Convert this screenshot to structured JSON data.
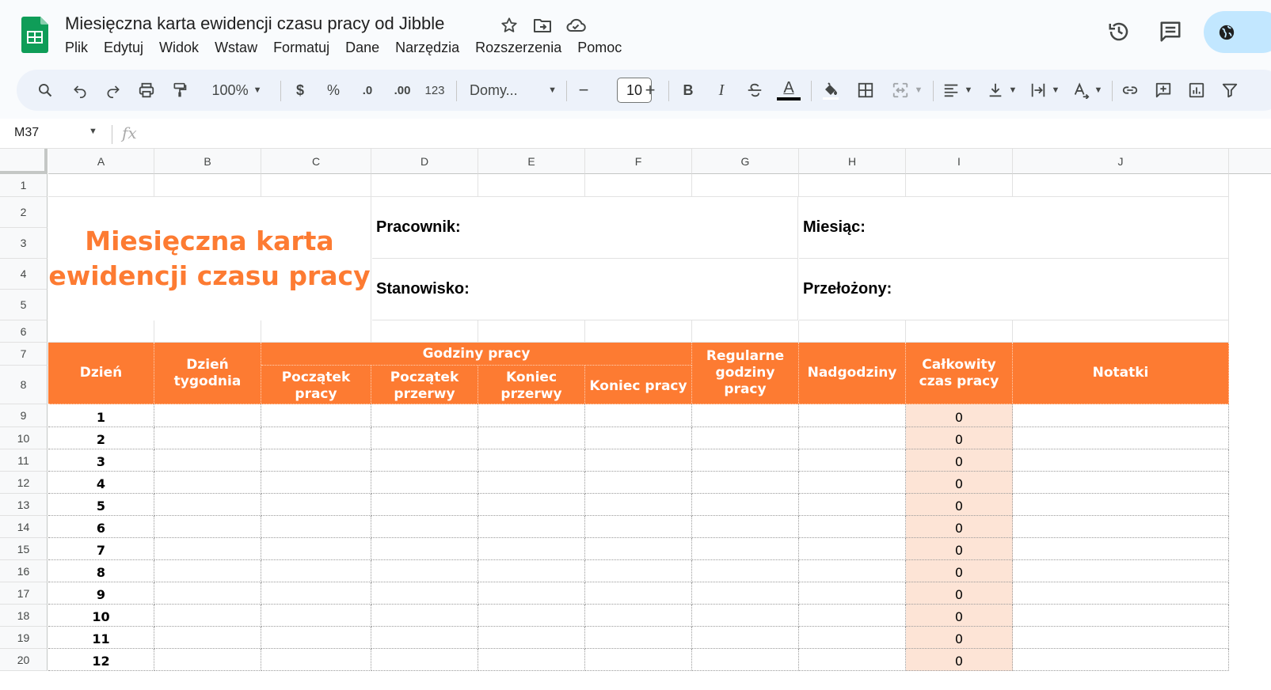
{
  "document": {
    "title": "Miesięczna karta ewidencji czasu pracy od Jibble"
  },
  "menu": [
    "Plik",
    "Edytuj",
    "Widok",
    "Wstaw",
    "Formatuj",
    "Dane",
    "Narzędzia",
    "Rozszerzenia",
    "Pomoc"
  ],
  "toolbar": {
    "zoom": "100%",
    "currency": "$",
    "percent": "%",
    "decrease_decimals": ".0",
    "increase_decimals": ".00",
    "number_format": "123",
    "font": "Domy...",
    "font_size": "10",
    "minus": "−",
    "plus": "+",
    "bold": "B",
    "italic": "I",
    "text_color_glyph": "A",
    "text_color": "#000000"
  },
  "formula_bar": {
    "cell_ref": "M37",
    "fx": "fx",
    "value": ""
  },
  "columns": [
    "A",
    "B",
    "C",
    "D",
    "E",
    "F",
    "G",
    "H",
    "I",
    "J"
  ],
  "rows": [
    "1",
    "2",
    "3",
    "4",
    "5",
    "6",
    "7",
    "8",
    "9",
    "10",
    "11",
    "12",
    "13",
    "14",
    "15",
    "16",
    "17",
    "18",
    "19",
    "20"
  ],
  "sheet": {
    "big_title": "Miesięczna karta ewidencji czasu pracy",
    "employee_label": "Pracownik:",
    "position_label": "Stanowisko:",
    "month_label": "Miesiąc:",
    "supervisor_label": "Przełożony:",
    "headers": {
      "day": "Dzień",
      "weekday": "Dzień tygodnia",
      "working_hours": "Godziny pracy",
      "start_work": "Początek pracy",
      "start_break": "Początek przerwy",
      "end_break": "Koniec przerwy",
      "end_work": "Koniec pracy",
      "regular_hours": "Regularne godziny pracy",
      "overtime": "Nadgodziny",
      "total": "Całkowity czas pracy",
      "notes": "Notatki"
    },
    "day_rows": [
      {
        "day": "1",
        "total": "0"
      },
      {
        "day": "2",
        "total": "0"
      },
      {
        "day": "3",
        "total": "0"
      },
      {
        "day": "4",
        "total": "0"
      },
      {
        "day": "5",
        "total": "0"
      },
      {
        "day": "6",
        "total": "0"
      },
      {
        "day": "7",
        "total": "0"
      },
      {
        "day": "8",
        "total": "0"
      },
      {
        "day": "9",
        "total": "0"
      },
      {
        "day": "10",
        "total": "0"
      },
      {
        "day": "11",
        "total": "0"
      },
      {
        "day": "12",
        "total": "0"
      }
    ]
  },
  "colors": {
    "accent_orange": "#fd7b32",
    "total_fill": "#fde4d6",
    "share_pill": "#c2e7ff",
    "sheets_green": "#0f9d58"
  }
}
